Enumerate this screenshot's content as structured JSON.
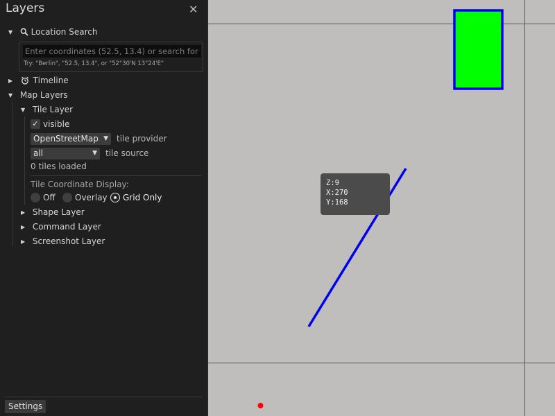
{
  "sidebar": {
    "title": "Layers",
    "close_glyph": "✕",
    "location_search": {
      "label": "Location Search",
      "placeholder": "Enter coordinates (52.5, 13.4) or search for a",
      "hint": "Try: \"Berlin\", \"52.5, 13.4\", or \"52°30'N 13°24'E\""
    },
    "timeline": {
      "label": "Timeline"
    },
    "map_layers": {
      "label": "Map Layers",
      "tile_layer": {
        "label": "Tile Layer",
        "visible_checked": true,
        "visible_label": "visible",
        "provider_value": "OpenStreetMap",
        "provider_label": "tile provider",
        "source_value": "all",
        "source_label": "tile source",
        "tiles_loaded": "0 tiles loaded",
        "coord_display_label": "Tile Coordinate Display:",
        "coord_options": [
          "Off",
          "Overlay",
          "Grid Only"
        ],
        "coord_selected": "Grid Only"
      },
      "shape_layer": "Shape Layer",
      "command_layer": "Command Layer",
      "screenshot_layer": "Screenshot Layer"
    },
    "settings_label": "Settings"
  },
  "map": {
    "tile_info": {
      "z": "Z:9",
      "x": "X:270",
      "y": "Y:168"
    },
    "colors": {
      "background": "#c0bebd",
      "grid": "#54545a",
      "line": "#0000ee",
      "rect_fill": "#00ff00",
      "rect_stroke": "#0000ee",
      "point": "#ff0000"
    }
  },
  "icons": {
    "search": "magnifier-icon",
    "timeline": "alarm-clock-icon",
    "close": "close-icon"
  }
}
